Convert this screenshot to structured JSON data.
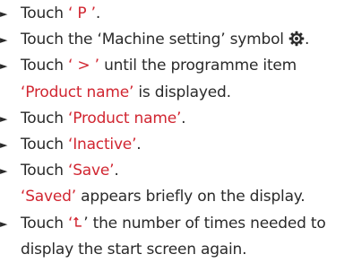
{
  "colors": {
    "text": "#2a2a2a",
    "highlight": "#d12631"
  },
  "bullet_symbol": "►",
  "steps": [
    {
      "text_a": "Touch ",
      "hl_a": "‘ P ’",
      "text_b": "."
    },
    {
      "text_a": "Touch the ‘Machine setting’ symbol",
      "icon": "gear-icon",
      "text_b": "."
    },
    {
      "text_a": "Touch ",
      "hl_a": "‘ > ’",
      "text_b": " until the programme item"
    },
    {
      "hl_a": "‘Product name’",
      "text_b": " is displayed."
    },
    {
      "text_a": "Touch ",
      "hl_a": "‘Product name’",
      "text_b": "."
    },
    {
      "text_a": "Touch ",
      "hl_a": "‘Inactive’",
      "text_b": "."
    },
    {
      "text_a": "Touch ",
      "hl_a": "‘Save’",
      "text_b": "."
    },
    {
      "hl_a": "‘Saved’",
      "text_b": " appears briefly on the display."
    },
    {
      "text_a": "Touch ",
      "hl_a": "‘",
      "text_b": "’ the number of times needed to",
      "icon": "back-arrow-icon"
    },
    {
      "text_b": "display the start screen again."
    }
  ]
}
